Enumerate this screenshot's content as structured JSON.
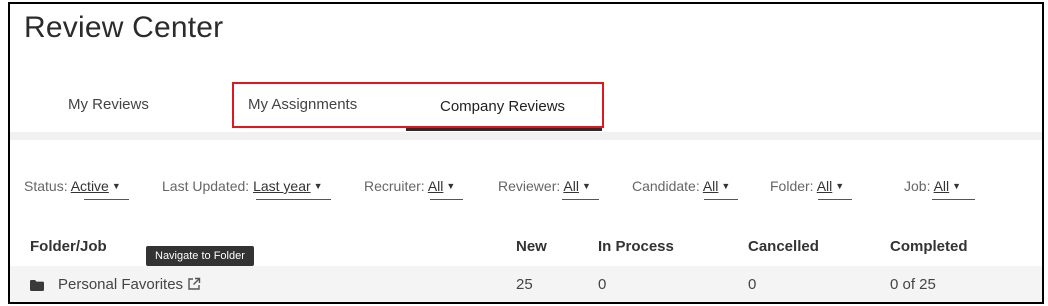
{
  "page": {
    "title": "Review Center"
  },
  "tabs": [
    {
      "label": "My Reviews"
    },
    {
      "label": "My Assignments"
    },
    {
      "label": "Company Reviews",
      "active": true
    }
  ],
  "filters": [
    {
      "label": "Status:",
      "value": "Active"
    },
    {
      "label": "Last Updated:",
      "value": "Last year"
    },
    {
      "label": "Recruiter:",
      "value": "All"
    },
    {
      "label": "Reviewer:",
      "value": "All"
    },
    {
      "label": "Candidate:",
      "value": "All"
    },
    {
      "label": "Folder:",
      "value": "All"
    },
    {
      "label": "Job:",
      "value": "All"
    }
  ],
  "table": {
    "columns": [
      "Folder/Job",
      "New",
      "In Process",
      "Cancelled",
      "Completed"
    ],
    "rows": [
      {
        "name": "Personal Favorites",
        "new": "25",
        "in_process": "0",
        "cancelled": "0",
        "completed": "0 of 25"
      }
    ]
  },
  "tooltip": {
    "text": "Navigate to Folder"
  },
  "icons": {
    "folder": "folder-icon",
    "external": "external-link-icon",
    "caret": "caret-down-icon"
  },
  "colors": {
    "highlight": "#e0171f",
    "text": "#333333"
  }
}
